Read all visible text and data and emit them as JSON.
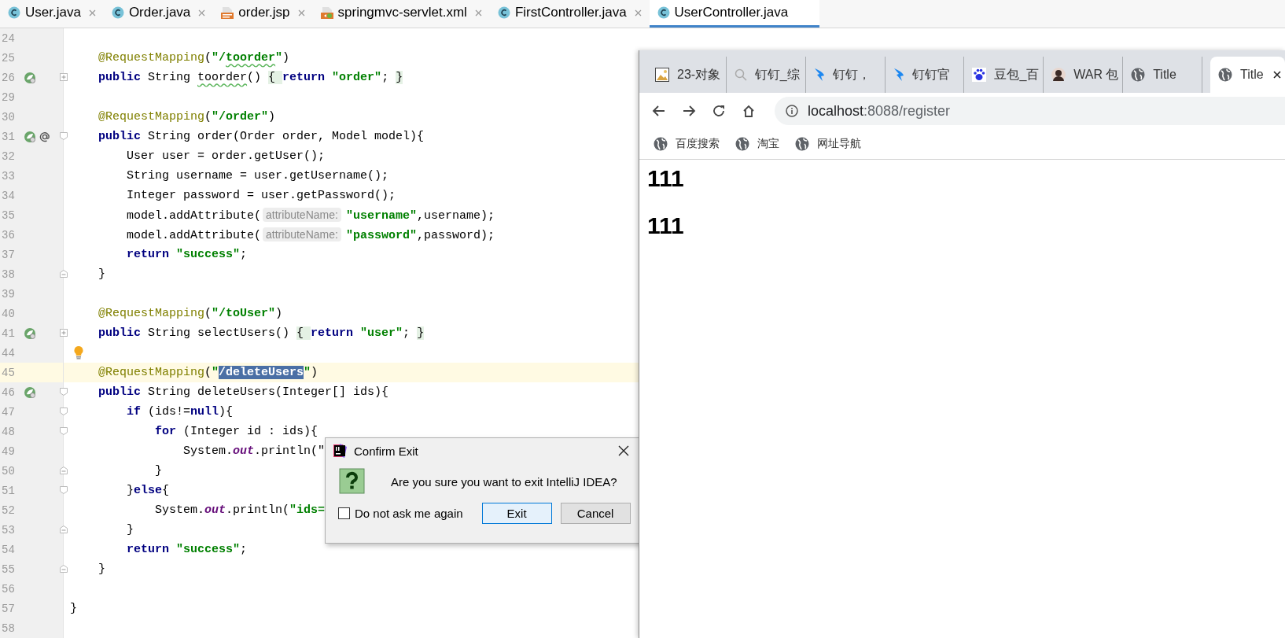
{
  "editor_tabs": [
    {
      "label": "User.java",
      "kind": "class",
      "selected": false
    },
    {
      "label": "Order.java",
      "kind": "class",
      "selected": false
    },
    {
      "label": "order.jsp",
      "kind": "jsp",
      "selected": false
    },
    {
      "label": "springmvc-servlet.xml",
      "kind": "xml",
      "selected": false
    },
    {
      "label": "FirstController.java",
      "kind": "class",
      "selected": false
    },
    {
      "label": "UserController.java",
      "kind": "class",
      "selected": true
    }
  ],
  "code_lines": [
    {
      "number": "24"
    },
    {
      "number": "25",
      "tokens": [
        {
          "kind": "annotation",
          "text": "    @RequestMapping"
        },
        {
          "kind": "plain",
          "text": "("
        },
        {
          "kind": "string",
          "text": "\"/"
        },
        {
          "kind": "string",
          "text": "toorder",
          "typo": true
        },
        {
          "kind": "string",
          "text": "\""
        },
        {
          "kind": "plain",
          "text": ")"
        }
      ]
    },
    {
      "number": "26",
      "spring_marker": true,
      "collapsed": true,
      "tokens": [
        {
          "kind": "keyword",
          "text": "    public "
        },
        {
          "kind": "plain",
          "text": "String "
        },
        {
          "kind": "plain",
          "text": "toorder",
          "typo": true
        },
        {
          "kind": "plain",
          "text": "() "
        },
        {
          "kind": "fold",
          "text": "{ "
        },
        {
          "kind": "keyword",
          "text": "return "
        },
        {
          "kind": "string",
          "text": "\"order\""
        },
        {
          "kind": "plain",
          "text": "; "
        },
        {
          "kind": "fold",
          "text": "}"
        }
      ]
    },
    {
      "number": "29"
    },
    {
      "number": "30",
      "tokens": [
        {
          "kind": "annotation",
          "text": "    @RequestMapping"
        },
        {
          "kind": "plain",
          "text": "("
        },
        {
          "kind": "string",
          "text": "\"/order\""
        },
        {
          "kind": "plain",
          "text": ")"
        }
      ]
    },
    {
      "number": "31",
      "spring_marker": true,
      "at_marker": true,
      "fold_start": true,
      "tokens": [
        {
          "kind": "keyword",
          "text": "    public "
        },
        {
          "kind": "plain",
          "text": "String order(Order order, Model model){"
        }
      ]
    },
    {
      "number": "32",
      "tokens": [
        {
          "kind": "plain",
          "text": "        User user = order.getUser();"
        }
      ]
    },
    {
      "number": "33",
      "tokens": [
        {
          "kind": "plain",
          "text": "        String username = user.getUsername();"
        }
      ]
    },
    {
      "number": "34",
      "tokens": [
        {
          "kind": "plain",
          "text": "        Integer password = user.getPassword();"
        }
      ]
    },
    {
      "number": "35",
      "tokens": [
        {
          "kind": "plain",
          "text": "        model.addAttribute("
        },
        {
          "kind": "hint",
          "text": "attributeName:"
        },
        {
          "kind": "string",
          "text": "\"username\""
        },
        {
          "kind": "plain",
          "text": ",username);"
        }
      ]
    },
    {
      "number": "36",
      "tokens": [
        {
          "kind": "plain",
          "text": "        model.addAttribute("
        },
        {
          "kind": "hint",
          "text": "attributeName:"
        },
        {
          "kind": "string",
          "text": "\"password\""
        },
        {
          "kind": "plain",
          "text": ",password);"
        }
      ]
    },
    {
      "number": "37",
      "tokens": [
        {
          "kind": "keyword",
          "text": "        return "
        },
        {
          "kind": "string",
          "text": "\"success\""
        },
        {
          "kind": "plain",
          "text": ";"
        }
      ]
    },
    {
      "number": "38",
      "fold_end": true,
      "tokens": [
        {
          "kind": "plain",
          "text": "    }"
        }
      ]
    },
    {
      "number": "39"
    },
    {
      "number": "40",
      "tokens": [
        {
          "kind": "annotation",
          "text": "    @RequestMapping"
        },
        {
          "kind": "plain",
          "text": "("
        },
        {
          "kind": "string",
          "text": "\"/toUser\""
        },
        {
          "kind": "plain",
          "text": ")"
        }
      ]
    },
    {
      "number": "41",
      "spring_marker": true,
      "collapsed": true,
      "tokens": [
        {
          "kind": "keyword",
          "text": "    public "
        },
        {
          "kind": "plain",
          "text": "String selectUsers() "
        },
        {
          "kind": "fold",
          "text": "{ "
        },
        {
          "kind": "keyword",
          "text": "return "
        },
        {
          "kind": "string",
          "text": "\"user\""
        },
        {
          "kind": "plain",
          "text": "; "
        },
        {
          "kind": "fold",
          "text": "}"
        }
      ]
    },
    {
      "number": "44",
      "intention": true
    },
    {
      "number": "45",
      "current": true,
      "tokens": [
        {
          "kind": "annotation",
          "text": "    @RequestMapping"
        },
        {
          "kind": "plain",
          "text": "("
        },
        {
          "kind": "string",
          "text": "\""
        },
        {
          "kind": "string",
          "text": "/deleteUsers",
          "selected": true
        },
        {
          "kind": "string",
          "text": "\""
        },
        {
          "kind": "plain",
          "text": ")"
        }
      ]
    },
    {
      "number": "46",
      "spring_marker": true,
      "fold_start": true,
      "tokens": [
        {
          "kind": "keyword",
          "text": "    public "
        },
        {
          "kind": "plain",
          "text": "String deleteUsers(Integer[] ids){"
        }
      ]
    },
    {
      "number": "47",
      "fold_start": true,
      "tokens": [
        {
          "kind": "keyword",
          "text": "        if "
        },
        {
          "kind": "plain",
          "text": "(ids!="
        },
        {
          "kind": "keyword",
          "text": "null"
        },
        {
          "kind": "plain",
          "text": "){"
        }
      ]
    },
    {
      "number": "48",
      "fold_start": true,
      "tokens": [
        {
          "kind": "keyword",
          "text": "            for "
        },
        {
          "kind": "plain",
          "text": "(Integer id : ids){"
        }
      ]
    },
    {
      "number": "49",
      "tokens": [
        {
          "kind": "plain",
          "text": "                System."
        },
        {
          "kind": "field",
          "text": "out"
        },
        {
          "kind": "plain",
          "text": ".println(\""
        }
      ]
    },
    {
      "number": "50",
      "fold_end": true,
      "tokens": [
        {
          "kind": "plain",
          "text": "            }"
        }
      ]
    },
    {
      "number": "51",
      "fold_start": true,
      "tokens": [
        {
          "kind": "plain",
          "text": "        }"
        },
        {
          "kind": "keyword",
          "text": "else"
        },
        {
          "kind": "plain",
          "text": "{"
        }
      ]
    },
    {
      "number": "52",
      "tokens": [
        {
          "kind": "plain",
          "text": "            System."
        },
        {
          "kind": "field",
          "text": "out"
        },
        {
          "kind": "plain",
          "text": ".println("
        },
        {
          "kind": "string",
          "text": "\"ids="
        }
      ]
    },
    {
      "number": "53",
      "fold_end": true,
      "tokens": [
        {
          "kind": "plain",
          "text": "        }"
        }
      ]
    },
    {
      "number": "54",
      "tokens": [
        {
          "kind": "keyword",
          "text": "        return "
        },
        {
          "kind": "string",
          "text": "\"success\""
        },
        {
          "kind": "plain",
          "text": ";"
        }
      ]
    },
    {
      "number": "55",
      "fold_end": true,
      "tokens": [
        {
          "kind": "plain",
          "text": "    }"
        }
      ]
    },
    {
      "number": "56"
    },
    {
      "number": "57",
      "tokens": [
        {
          "kind": "plain",
          "text": "}"
        }
      ]
    },
    {
      "number": "58"
    }
  ],
  "dialog": {
    "title": "Confirm Exit",
    "message": "Are you sure you want to exit IntelliJ IDEA?",
    "checkbox": {
      "label": "Do not ask me again",
      "checked": false
    },
    "buttons": [
      {
        "label": "Exit",
        "default": true
      },
      {
        "label": "Cancel",
        "default": false
      }
    ]
  },
  "browser": {
    "tabs": [
      {
        "label": "23-对象",
        "kind": "image",
        "selected": false
      },
      {
        "label": "钉钉_综",
        "kind": "search",
        "selected": false
      },
      {
        "label": "钉钉，",
        "kind": "wing",
        "selected": false
      },
      {
        "label": "钉钉官",
        "kind": "wing",
        "selected": false
      },
      {
        "label": "豆包_百",
        "kind": "paw",
        "selected": false
      },
      {
        "label": "WAR 包",
        "kind": "avatar",
        "selected": false
      },
      {
        "label": "Title",
        "kind": "globe",
        "selected": false
      },
      {
        "label": "Title",
        "kind": "globe",
        "selected": true
      }
    ],
    "address": {
      "host": "localhost",
      "path": ":8088/register"
    },
    "bookmarks": [
      "百度搜索",
      "淘宝",
      "网址导航"
    ],
    "content": [
      "111",
      "111"
    ]
  }
}
